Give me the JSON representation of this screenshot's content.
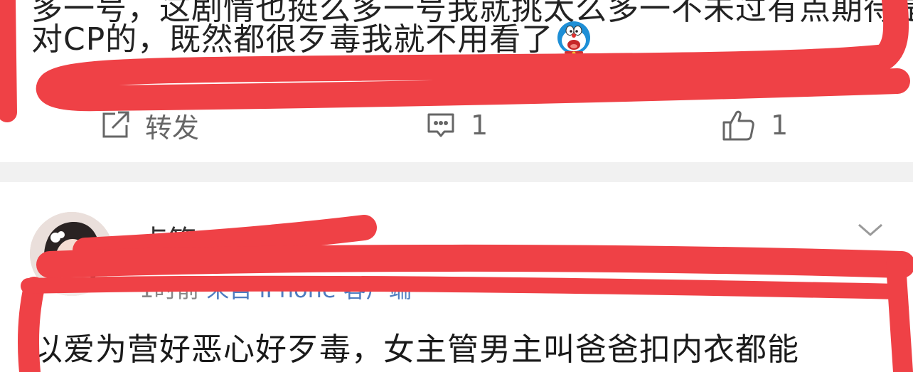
{
  "post": {
    "cut_line": "多一号，这剧情也挺么多一号我就挑太么多一不未过有点期待是",
    "text": "对CP的，既然都很歹毒我就不用看了",
    "emoji": "doraemon-face-icon"
  },
  "actions": {
    "repost_label": "转发",
    "comment_count": "1",
    "like_count": "1"
  },
  "comment": {
    "username": "点箱",
    "time": "1时前",
    "source": "来自 iPhone 客户端",
    "text": "以爱为营好恶心好歹毒，女主管男主叫爸爸扣内衣都能"
  },
  "colors": {
    "marker_red": "#ef4146",
    "meta_blue": "#4f7dc0",
    "icon_gray": "#666666",
    "divider_gray": "#f1f1f1"
  }
}
